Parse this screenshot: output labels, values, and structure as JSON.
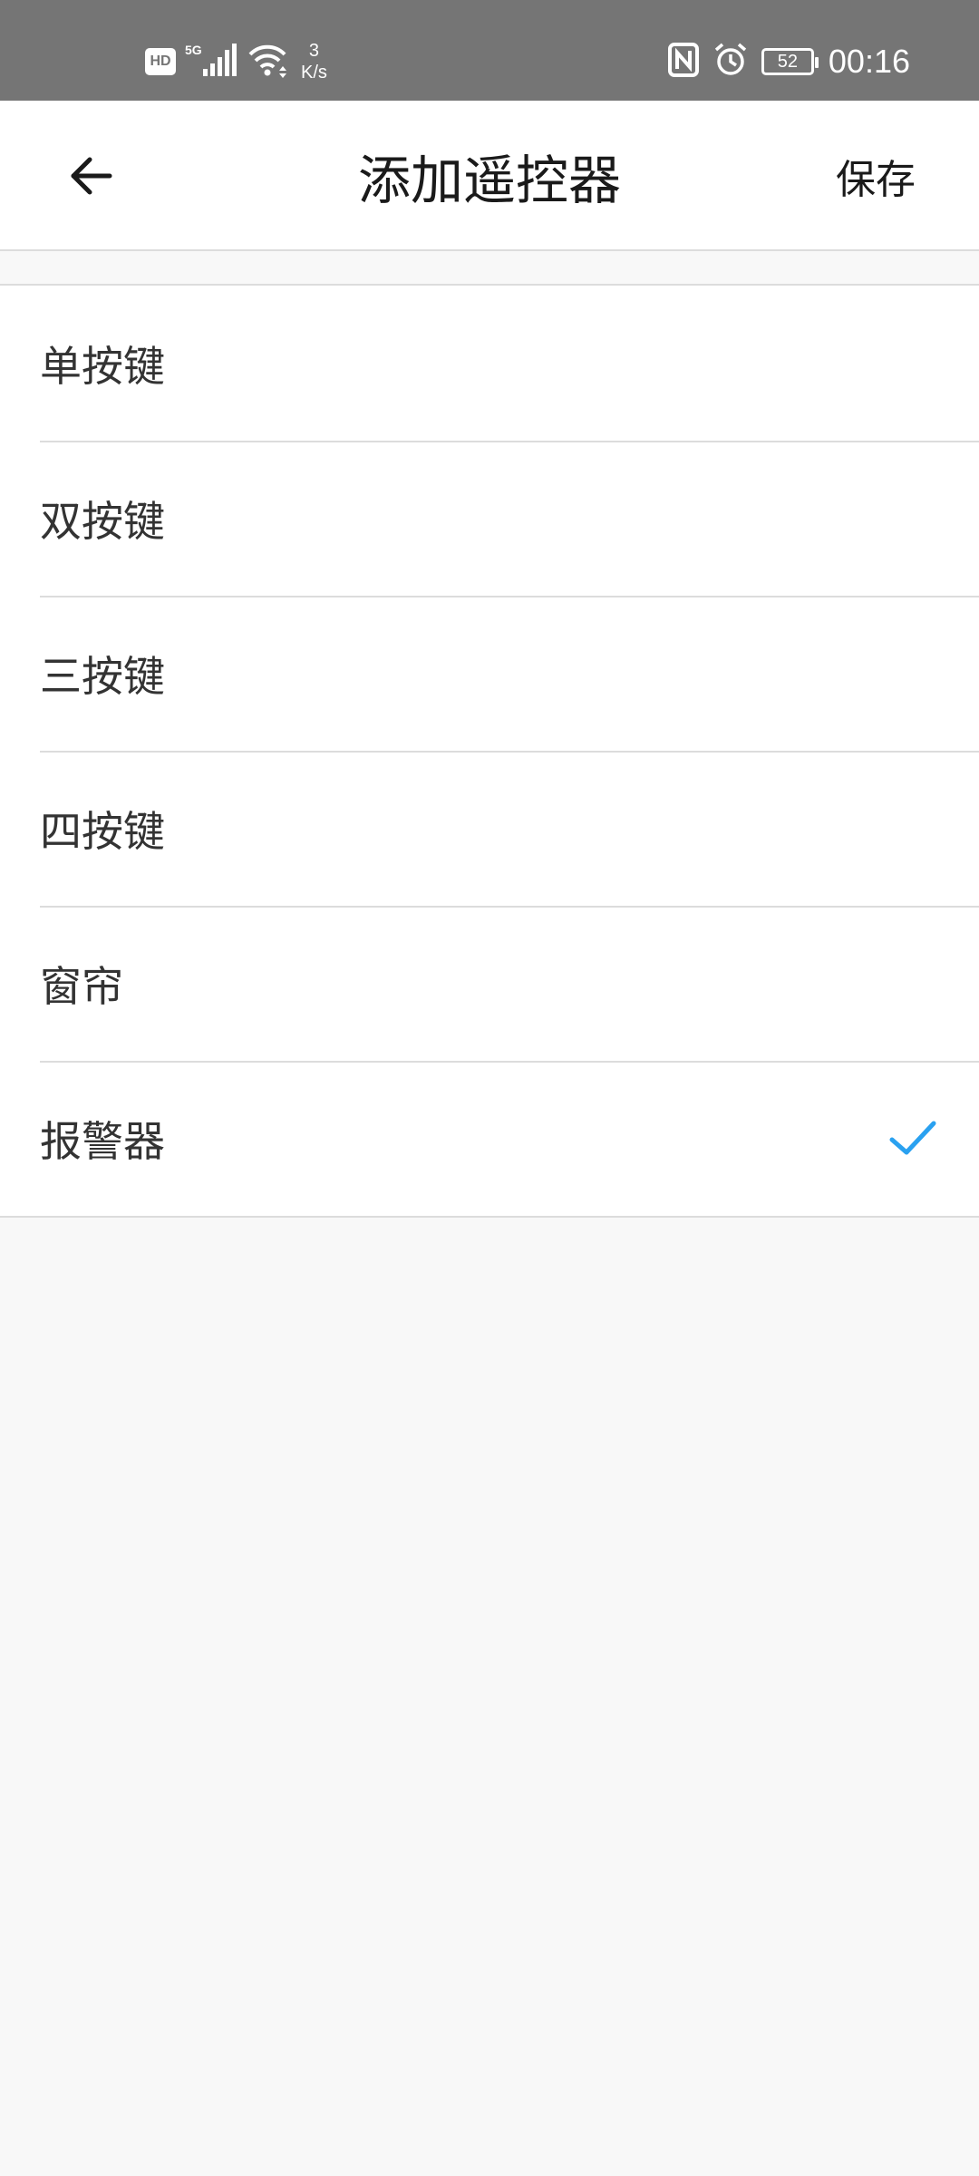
{
  "status_bar": {
    "hd_label": "HD",
    "net_speed_value": "3",
    "net_speed_unit": "K/s",
    "battery_level": "52",
    "time": "00:16",
    "icons": [
      "hd-icon",
      "5g-signal-icon",
      "wifi-icon",
      "nfc-icon",
      "alarm-icon",
      "battery-icon"
    ]
  },
  "app_bar": {
    "title": "添加遥控器",
    "save_label": "保存",
    "back_icon": "arrow-left-icon"
  },
  "remote_types": [
    {
      "label": "单按键",
      "selected": false
    },
    {
      "label": "双按键",
      "selected": false
    },
    {
      "label": "三按键",
      "selected": false
    },
    {
      "label": "四按键",
      "selected": false
    },
    {
      "label": "窗帘",
      "selected": false
    },
    {
      "label": "报警器",
      "selected": true
    }
  ],
  "colors": {
    "status_bar_bg": "#757575",
    "page_bg": "#f8f8f8",
    "accent_check": "#2aa1f0",
    "divider": "#dcdcdc"
  }
}
